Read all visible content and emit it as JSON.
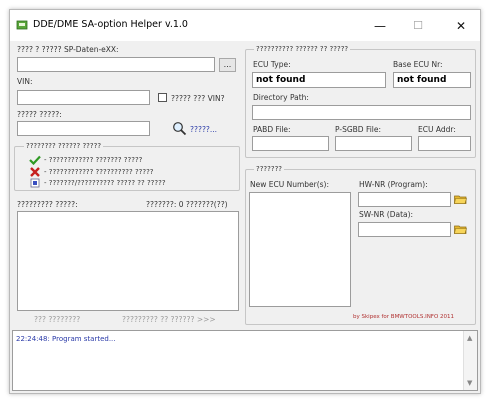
{
  "window": {
    "title": "DDE/DME SA-option Helper  v.1.0",
    "controls": {
      "minimize": "—",
      "maximize": "☐",
      "close": "✕"
    }
  },
  "left": {
    "sp_daten_label": "???? ? ????? SP-Daten-eXX:",
    "browse_label": "...",
    "vin_label": "VIN:",
    "vin_checkbox_label": "????? ??? VIN?",
    "second_label": "????? ?????:",
    "search_link": "?????...",
    "legend": {
      "title": "???????? ?????? ?????",
      "rows": [
        {
          "icon": "green-check-icon",
          "text": "- ???????????? ??????? ?????"
        },
        {
          "icon": "red-cross-icon",
          "text": "- ???????????? ?????????? ?????"
        },
        {
          "icon": "blue-dot-icon",
          "text": "- ???????/?????????? ????? ?? ?????"
        }
      ]
    },
    "list_label": "????????? ?????:",
    "list_count": "???????: 0 ???????(??)",
    "btn_left": "??? ????????",
    "btn_right": "????????? ?? ?????? >>>"
  },
  "right": {
    "group1_title": "?????????? ?????? ?? ?????",
    "ecu_type_label": "ECU Type:",
    "ecu_type_value": "not found",
    "base_ecu_label": "Base ECU Nr:",
    "base_ecu_value": "not found",
    "directory_label": "Directory Path:",
    "pabd_label": "PABD File:",
    "psgbd_label": "P-SGBD File:",
    "ecu_addr_label": "ECU Addr:",
    "group2_title": "???????",
    "new_ecu_label": "New ECU Number(s):",
    "hw_label": "HW-NR (Program):",
    "sw_label": "SW-NR (Data):",
    "credit": "by Skipex for BMWTOOLS.INFO 2011"
  },
  "log": {
    "lines": [
      "22:24:48:  Program started..."
    ]
  },
  "colors": {
    "window_bg": "#f0f0f0",
    "log_text": "#2a3aa8",
    "credit_text": "#b03030"
  }
}
